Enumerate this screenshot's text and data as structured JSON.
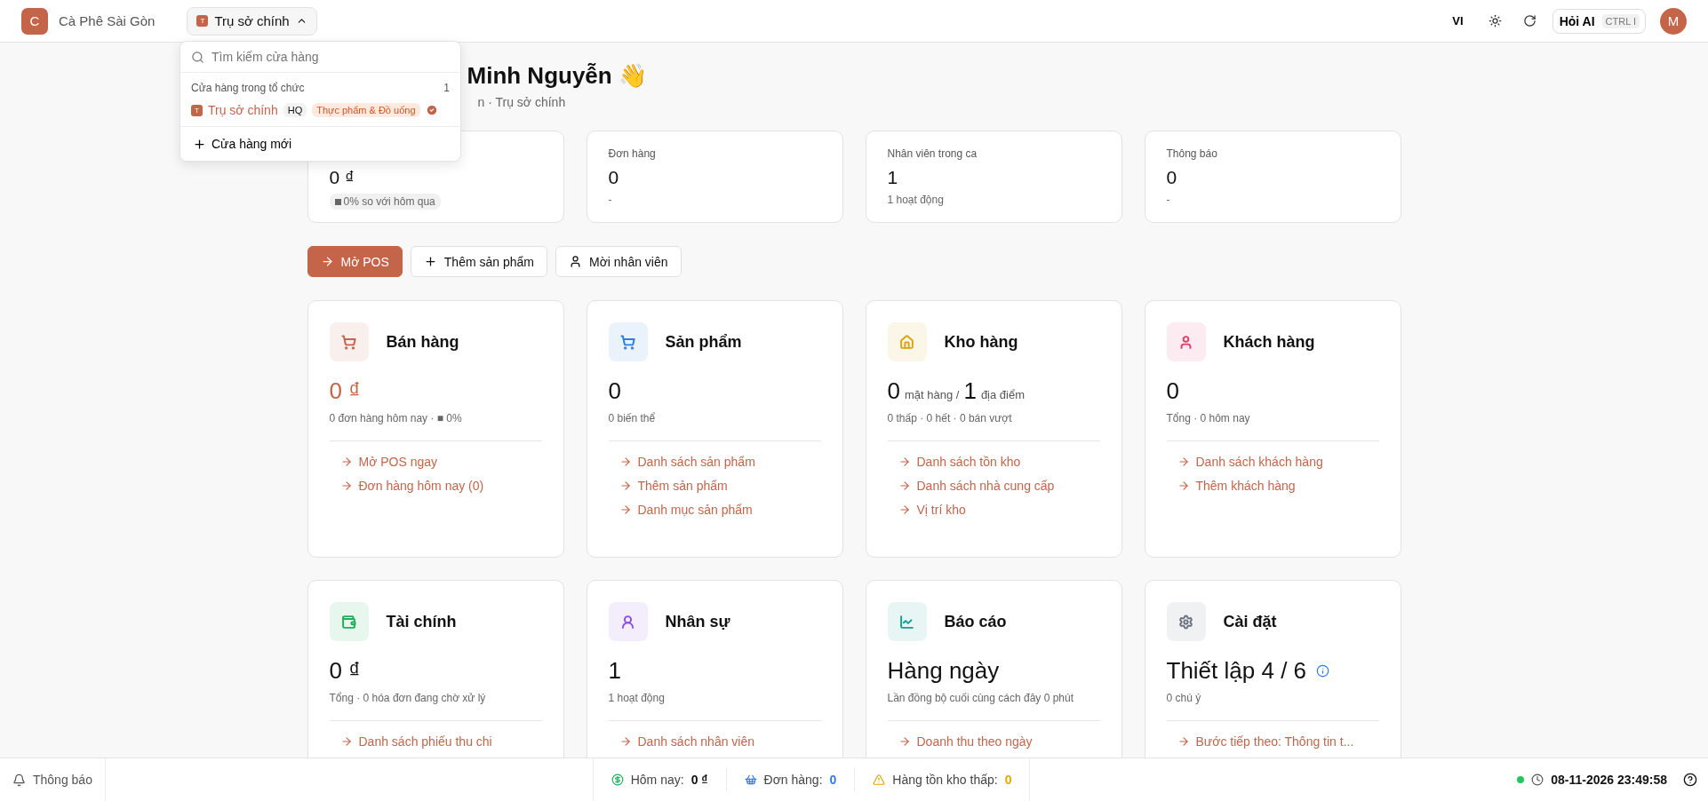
{
  "topbar": {
    "brand_initial": "C",
    "brand_name": "Cà Phê Sài Gòn",
    "store_badge": "T",
    "store_name": "Trụ sở chính",
    "language": "VI",
    "ai_button": "Hỏi AI",
    "ai_shortcut": "CTRL I",
    "avatar": "M"
  },
  "store_menu": {
    "expanded": true,
    "search_placeholder": "Tìm kiếm cửa hàng",
    "section_title": "Cửa hàng trong tổ chức",
    "section_count": "1",
    "stores": [
      {
        "badge": "T",
        "name": "Trụ sở chính",
        "tag": "HQ",
        "category": "Thực phẩm & Đồ uống",
        "selected": true
      }
    ],
    "new_store": "Cửa hàng mới"
  },
  "greeting": {
    "title": "Minh Nguyễn 👋",
    "subtitle": "n · Trụ sở chính"
  },
  "stats": [
    {
      "value": "0 ₫",
      "note": "0% so với hôm qua",
      "kind": "badge"
    },
    {
      "label": "Đơn hàng",
      "value": "0",
      "note": "-",
      "kind": "plain"
    },
    {
      "label": "Nhân viên trong ca",
      "value": "1",
      "note": "1 hoạt động",
      "kind": "plain"
    },
    {
      "label": "Thông báo",
      "value": "0",
      "note": "-",
      "kind": "plain"
    }
  ],
  "actions": [
    {
      "label": "Mở POS",
      "primary": true
    },
    {
      "label": "Thêm sản phẩm",
      "primary": false
    },
    {
      "label": "Mời nhân viên",
      "primary": false
    }
  ],
  "modules": [
    {
      "title": "Bán hàng",
      "color": "#c4654a",
      "accent": true,
      "info": false,
      "value": [
        {
          "text": "0 ₫",
          "kind": "big"
        }
      ],
      "sub": "0 đơn hàng hôm nay · ■ 0%",
      "links": [
        "Mở POS ngay",
        "Đơn hàng hôm nay (0)"
      ]
    },
    {
      "title": "Sản phẩm",
      "color": "#2f7de1",
      "accent": false,
      "info": false,
      "value": [
        {
          "text": "0",
          "kind": "big"
        }
      ],
      "sub": "0 biến thể",
      "links": [
        "Danh sách sản phẩm",
        "Thêm sản phẩm",
        "Danh mục sản phẩm"
      ]
    },
    {
      "title": "Kho hàng",
      "color": "#d9a514",
      "accent": false,
      "info": false,
      "value": [
        {
          "text": "0",
          "kind": "big"
        },
        {
          "text": "mặt hàng /",
          "kind": "unit"
        },
        {
          "text": "1",
          "kind": "big"
        },
        {
          "text": "địa điểm",
          "kind": "unit"
        }
      ],
      "sub": "0 thấp · 0 hết · 0 bán vượt",
      "links": [
        "Danh sách tồn kho",
        "Danh sách nhà cung cấp",
        "Vị trí kho"
      ]
    },
    {
      "title": "Khách hàng",
      "color": "#e03e6a",
      "accent": false,
      "info": false,
      "value": [
        {
          "text": "0",
          "kind": "big"
        }
      ],
      "sub": "Tổng · 0 hôm nay",
      "links": [
        "Danh sách khách hàng",
        "Thêm khách hàng"
      ]
    },
    {
      "title": "Tài chính",
      "color": "#1fae5b",
      "accent": false,
      "info": false,
      "value": [
        {
          "text": "0 ₫",
          "kind": "big"
        }
      ],
      "sub": "Tổng · 0 hóa đơn đang chờ xử lý",
      "links": [
        "Danh sách phiếu thu chi"
      ]
    },
    {
      "title": "Nhân sự",
      "color": "#8b4fe0",
      "accent": false,
      "info": false,
      "value": [
        {
          "text": "1",
          "kind": "big"
        }
      ],
      "sub": "1 hoạt động",
      "links": [
        "Danh sách nhân viên"
      ]
    },
    {
      "title": "Báo cáo",
      "color": "#159f8f",
      "accent": false,
      "info": false,
      "value": [
        {
          "text": "Hàng ngày",
          "kind": "big"
        }
      ],
      "sub": "Lần đồng bộ cuối cùng cách đây 0 phút",
      "links": [
        "Doanh thu theo ngày"
      ]
    },
    {
      "title": "Cài đặt",
      "color": "#6b7280",
      "accent": false,
      "info": true,
      "value": [
        {
          "text": "Thiết lập 4 / 6",
          "kind": "big"
        }
      ],
      "sub": "0 chú ý",
      "links": [
        "Bước tiếp theo: Thông tin t..."
      ]
    }
  ],
  "footer": {
    "notifications": "Thông báo",
    "today_label": "Hôm nay:",
    "today_value": "0 ₫",
    "orders_label": "Đơn hàng:",
    "orders_value": "0",
    "low_stock_label": "Hàng tồn kho thấp:",
    "low_stock_value": "0",
    "online": true,
    "datetime": "08-11-2026 23:49:58"
  }
}
